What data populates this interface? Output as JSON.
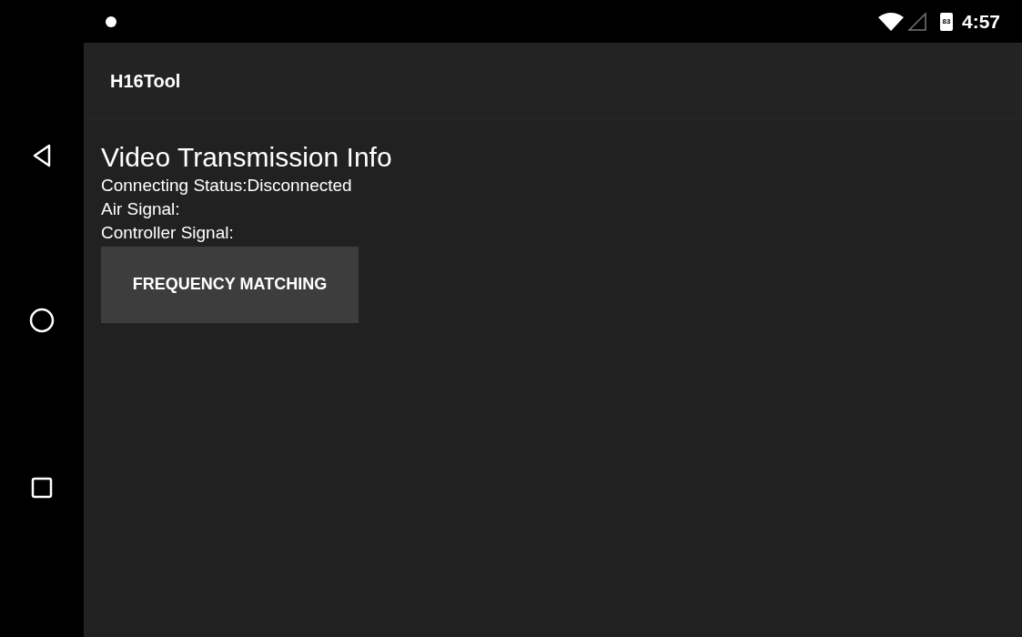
{
  "status_bar": {
    "battery": "83",
    "time": "4:57"
  },
  "app_bar": {
    "title": "H16Tool"
  },
  "content": {
    "heading": "Video Transmission Info",
    "lines": [
      "Connecting Status:Disconnected",
      "Air Signal:",
      "Controller Signal:"
    ],
    "button": "FREQUENCY MATCHING"
  }
}
